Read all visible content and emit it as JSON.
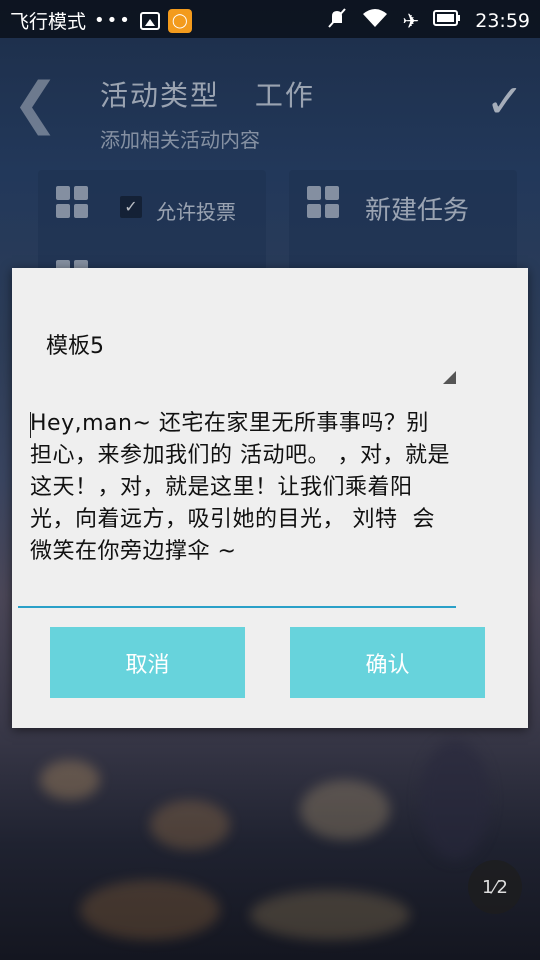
{
  "status_bar": {
    "airplane_mode_label": "飞行模式",
    "overflow_dots": "•••",
    "time": "23:59",
    "icons": [
      "image-icon",
      "game-icon",
      "mute-icon",
      "wifi-icon",
      "airplane-icon",
      "battery-icon"
    ]
  },
  "header": {
    "title": "活动类型",
    "type_value": "工作",
    "subtitle": "添加相关活动内容"
  },
  "tiles": {
    "vote_label": "允许投票",
    "new_task_label": "新建任务"
  },
  "dialog": {
    "template_value": "模板5",
    "message": "Hey,man~ 还宅在家里无所事事吗？别担心，来参加我们的 活动吧。 ，对，就是这天！，对，就是这里！让我们乘着阳光，向着远方，吸引她的目光， 刘特  会微笑在你旁边撑伞 ~",
    "cancel_label": "取消",
    "confirm_label": "确认"
  },
  "page_indicator": {
    "current": "1",
    "total": "2"
  },
  "colors": {
    "button_bg": "#67d3dc",
    "input_underline": "#2aa0c8",
    "dialog_bg": "#efefef",
    "status_icon_game": "#f39b1d"
  }
}
